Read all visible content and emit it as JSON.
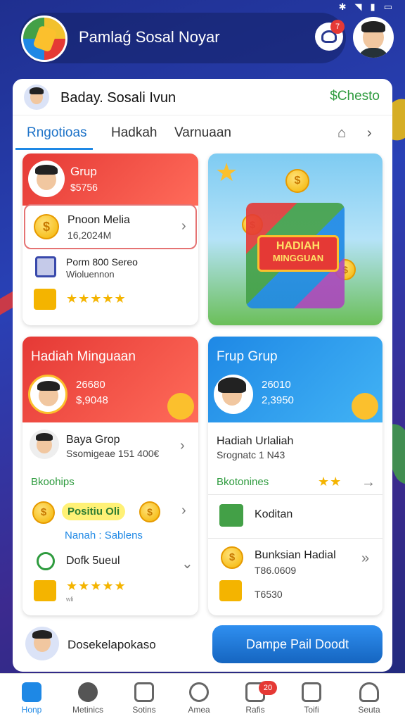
{
  "app": {
    "title": "Pamlaǵ Sosal Noyar",
    "notif_count": "7"
  },
  "user_row": {
    "name": "Baday. Sosali Ivun",
    "check": "$Chesto"
  },
  "tabs": [
    {
      "label": "Rngotioas"
    },
    {
      "label": "Hadkah"
    },
    {
      "label": "Varnuaan"
    }
  ],
  "panel1": {
    "header_title": "Grup",
    "header_value": "$5756",
    "item1_title": "Pnoon Melia",
    "item1_sub": "16,2024M",
    "item2_title": "Porm 800 Sereo",
    "item2_sub": "Wioluennon"
  },
  "panel2": {
    "banner_line1": "HADIAH",
    "banner_line2": "MINGGUAN"
  },
  "panel3": {
    "header_title": "Hadiah Minguaan",
    "stat1": "26680",
    "stat2": "$,9048",
    "item1_title": "Baya Grop",
    "item1_sub": "Ssomigeae 151 400€",
    "section_label": "Bkoohips",
    "pill_label": "Positiu Oli",
    "link_label": "Nanah : Sablens",
    "item3_title": "Dofk 5ueul",
    "footnote": "wli"
  },
  "panel4": {
    "header_title": "Frup Grup",
    "stat1": "26010",
    "stat2": "2,3950",
    "item1_title": "Hadiah Urlaliah",
    "item1_sub": "Srognatc 1 N43",
    "section_label": "Bkotonines",
    "item2_title": "Koditan",
    "item3_title": "Bunksian Hadial",
    "item3_sub": "T86.0609",
    "item4_sub": "T6530"
  },
  "footer_user": {
    "name": "Dosekelapokaso"
  },
  "cta": {
    "label": "Dampe Pail Doodt"
  },
  "nav": [
    {
      "label": "Honp"
    },
    {
      "label": "Metinics"
    },
    {
      "label": "Sotins"
    },
    {
      "label": "Amea"
    },
    {
      "label": "Rafis",
      "badge": "20"
    },
    {
      "label": "Toifi"
    },
    {
      "label": "Seuta"
    }
  ]
}
